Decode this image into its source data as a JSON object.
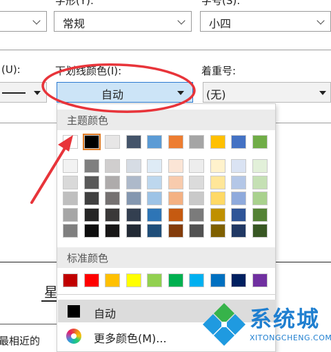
{
  "top_row": {
    "style_label": "字形(Y):",
    "style_value": "常规",
    "size_label": "字号(S):",
    "size_value": "小四"
  },
  "mid_row": {
    "underline_label": "(U):",
    "underline_color_label": "下划线颜色(I):",
    "underline_color_value": "自动",
    "emphasis_label": "着重号:",
    "emphasis_value": "(无)"
  },
  "dropdown": {
    "theme_header": "主题颜色",
    "standard_header": "标准颜色",
    "auto_label": "自动",
    "more_label": "更多颜色(M)..."
  },
  "background_text": {
    "preview_char": "星",
    "bottom_text": "最相近的"
  },
  "watermark": {
    "name": "系统城",
    "url": "XITONGCHENG.COM"
  },
  "colors": {
    "highlight_ring": "#e8343a",
    "selected_border": "#2b79d0",
    "selected_fill": "#cce4f7",
    "watermark_blue": "#1f9ae0",
    "watermark_green": "#37b34a"
  },
  "theme_colors": [
    [
      "#ffffff",
      "#000000",
      "#e7e6e6",
      "#44546a",
      "#5b9bd5",
      "#ed7d31",
      "#a5a5a5",
      "#ffc000",
      "#4472c4",
      "#70ad47"
    ],
    [
      "#f2f2f2",
      "#7f7f7f",
      "#d0cece",
      "#d6dce4",
      "#deebf6",
      "#fbe5d6",
      "#ededed",
      "#fff2cc",
      "#dae3f3",
      "#e2f0d9"
    ],
    [
      "#d9d9d9",
      "#595959",
      "#aeabab",
      "#adb9ca",
      "#bdd7ee",
      "#f8cbad",
      "#dbdbdb",
      "#ffe699",
      "#b4c7e7",
      "#c5e0b4"
    ],
    [
      "#bfbfbf",
      "#404040",
      "#757171",
      "#8497b0",
      "#9dc3e6",
      "#f4b183",
      "#c9c9c9",
      "#ffd966",
      "#8faadc",
      "#a9d18e"
    ],
    [
      "#a6a6a6",
      "#262626",
      "#3a3838",
      "#333f50",
      "#2e75b6",
      "#c55a11",
      "#7b7b7b",
      "#bf9000",
      "#2f5597",
      "#548235"
    ],
    [
      "#7f7f7f",
      "#0d0d0d",
      "#171616",
      "#222a35",
      "#1f4e79",
      "#833c0b",
      "#525252",
      "#7f6000",
      "#203864",
      "#385723"
    ]
  ],
  "standard_colors": [
    "#c00000",
    "#ff0000",
    "#ffc000",
    "#ffff00",
    "#92d050",
    "#00b050",
    "#00b0f0",
    "#0070c0",
    "#002060",
    "#7030a0"
  ]
}
